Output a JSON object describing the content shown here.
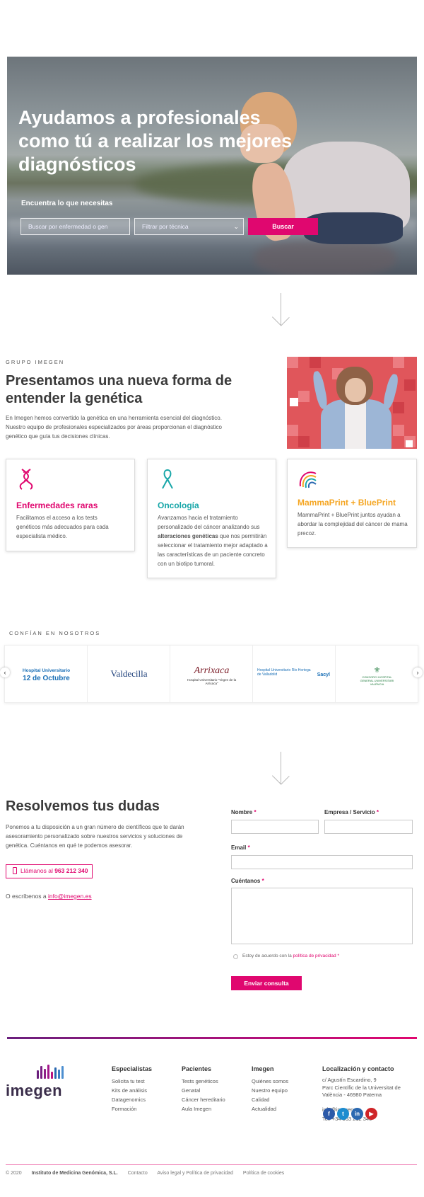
{
  "hero": {
    "title": "Ayudamos a profesionales como tú a realizar los mejores diagnósticos",
    "subtitle": "Encuentra lo que necesitas",
    "search_placeholder": "Buscar por enfermedad o gen",
    "select_placeholder": "Filtrar por técnica",
    "search_button": "Buscar"
  },
  "group": {
    "kicker": "GRUPO IMEGEN",
    "title": "Presentamos una nueva forma de entender la genética",
    "text": "En Imegen hemos convertido la genética en una herramienta esencial del diagnóstico. Nuestro equipo de profesionales especializados por áreas proporcionan el diagnóstico genético que guía tus decisiones clínicas."
  },
  "cards": {
    "rare": {
      "title": "Enfermedades raras",
      "text": "Facilitamos el acceso a los tests genéticos más adecuados para cada especialista médico."
    },
    "onco": {
      "title": "Oncología",
      "text_before": "Avanzamos hacia el tratamiento personalizado del cáncer analizando sus ",
      "text_bold": "alteraciones genéticas",
      "text_after": " que nos permitirán seleccionar el tratamiento mejor adaptado a las características de un paciente concreto con un biotipo tumoral."
    },
    "mamma": {
      "title": "MammaPrint + BluePrint",
      "text": "MammaPrint + BluePrint juntos ayudan a abordar la complejidad del cáncer de mama precoz."
    }
  },
  "trust": {
    "kicker": "CONFÍAN EN NOSOTROS",
    "logos": [
      {
        "line1": "Hospital Universitario",
        "line2": "12 de Octubre"
      },
      {
        "line1": "Valdecilla"
      },
      {
        "line1": "Arrixaca",
        "line2": "Hospital Universitario \"Virgen de la Arrixaca\""
      },
      {
        "line1": "Hospital Universitario Río Hortega de Valladolid",
        "line2": "Sacyl"
      },
      {
        "line1": "CONSORCI HOSPITAL GENERAL UNIVERSITARI VALÈNCIA"
      }
    ]
  },
  "faq": {
    "title": "Resolvemos tus dudas",
    "text": "Ponemos a tu disposición a un gran número de científicos que te darán asesoramiento personalizado sobre nuestros servicios y soluciones de genética. Cuéntanos en qué te podemos asesorar.",
    "call_prefix": "Llámanos al ",
    "call_number": "963 212 340",
    "write_prefix": "O escríbenos a ",
    "write_email": "info@imegen.es"
  },
  "form": {
    "name_label": "Nombre",
    "company_label": "Empresa / Servicio",
    "email_label": "Email",
    "message_label": "Cuéntanos",
    "required_mark": "*",
    "privacy_prefix": "Estoy de acuerdo con la ",
    "privacy_link": "política de privacidad",
    "submit": "Enviar consulta"
  },
  "footer": {
    "logo": "imegen",
    "col_esp": {
      "title": "Especialistas",
      "items": [
        "Solicita tu test",
        "Kits de análisis",
        "Datagenomics",
        "Formación"
      ]
    },
    "col_pac": {
      "title": "Pacientes",
      "items": [
        "Tests genéticos",
        "Genatal",
        "Cáncer hereditario",
        "Aula Imegen"
      ]
    },
    "col_img": {
      "title": "Imegen",
      "items": [
        "Quiénes somos",
        "Nuestro equipo",
        "Calidad",
        "Actualidad"
      ]
    },
    "col_loc": {
      "title": "Localización y contacto",
      "address1": "c/ Agustín Escardino, 9",
      "address2": "Parc Científic de la Universitat de",
      "address3": "València - 46980 Paterna",
      "email": "info@imegen.es",
      "phone": "Tel: +34 963 212 340"
    },
    "social": {
      "fb": "f",
      "tw": "t",
      "li": "in",
      "yt": "▶"
    }
  },
  "bottom": {
    "copyright_prefix": "© 2020 ",
    "company": "Instituto de Medicina Genómica, S.L.",
    "contact": "Contacto",
    "legal": "Aviso legal y Política de privacidad",
    "cookies": "Política de cookies"
  },
  "colors": {
    "accent": "#e0076f",
    "teal": "#17a6a8",
    "orange": "#f5a623"
  }
}
